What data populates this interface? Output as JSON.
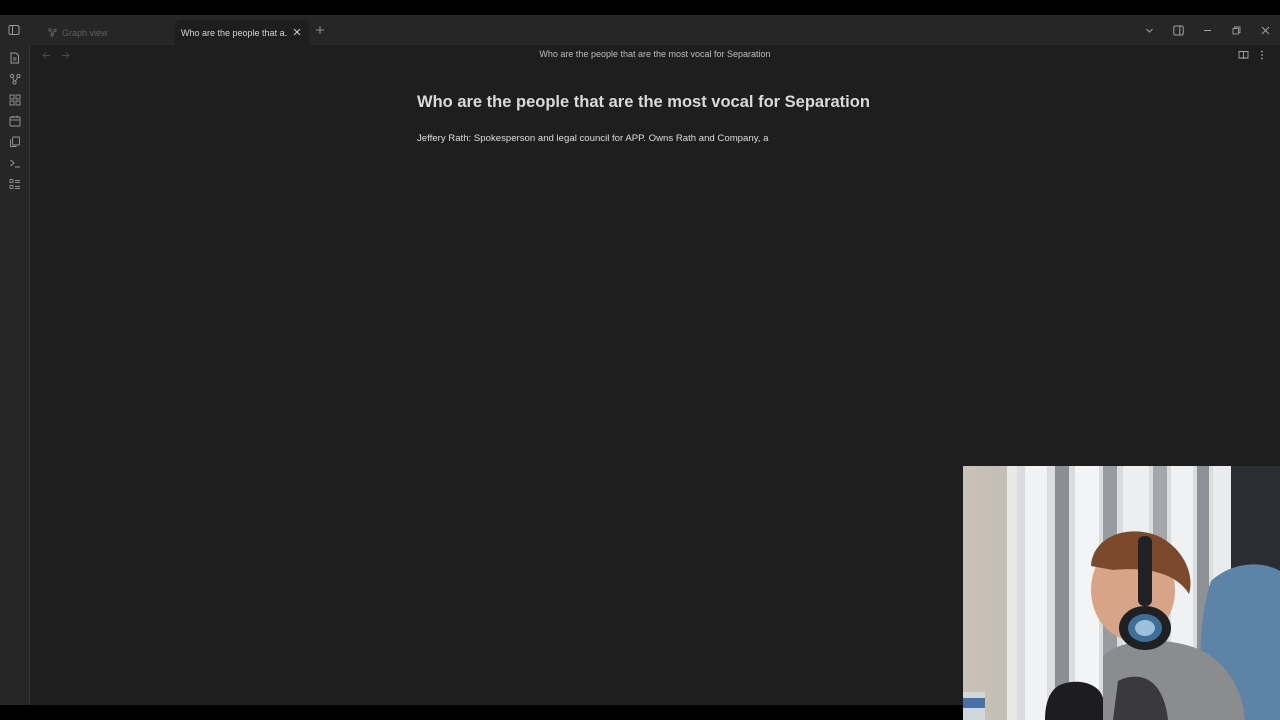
{
  "tabs": [
    {
      "label": "Graph view",
      "active": false,
      "icon": "graph-icon"
    },
    {
      "label": "Who are the people that are the most vocal for Separation",
      "active": true,
      "icon": null
    }
  ],
  "view": {
    "title": "Who are the people that are the most vocal for Separation"
  },
  "note": {
    "heading": "Who are the people that are the most vocal for Separation",
    "body": "Jeffery Rath: Spokesperson and legal council for APP. Owns Rath and Company, a"
  },
  "ribbon": [
    {
      "name": "open-quick-switcher-icon"
    },
    {
      "name": "graph-view-icon"
    },
    {
      "name": "canvas-icon"
    },
    {
      "name": "daily-notes-icon"
    },
    {
      "name": "templates-icon"
    },
    {
      "name": "command-palette-icon"
    },
    {
      "name": "outline-icon"
    }
  ],
  "colors": {
    "background": "#1e1e1e",
    "tabbar": "#262626",
    "heading": "#dadada",
    "text": "#dcddde",
    "muted": "#5f5f5f"
  }
}
